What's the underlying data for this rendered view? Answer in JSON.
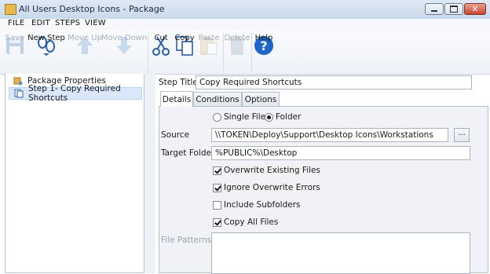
{
  "window": {
    "title": "All Users Desktop Icons - Package"
  },
  "menu": [
    "FILE",
    "EDIT",
    "STEPS",
    "VIEW"
  ],
  "ribbon": {
    "save": "Save",
    "new_step": "New Step",
    "move_up": "Move Up",
    "move_down": "Move Down",
    "cut": "Cut",
    "copy": "Copy",
    "paste": "Paste",
    "delete": "Delete",
    "help": "Help"
  },
  "tree": {
    "items": [
      {
        "label": "Package Properties",
        "icon": "package-properties-icon"
      },
      {
        "label": "Step 1- Copy Required Shortcuts",
        "icon": "step-copy-icon"
      }
    ]
  },
  "step": {
    "title_label": "Step Title",
    "title_value": "Copy Required Shortcuts",
    "tabs": [
      "Details",
      "Conditions",
      "Options"
    ],
    "mode": {
      "single_file": "Single File",
      "folder": "Folder",
      "selected": "Folder"
    },
    "source_label": "Source",
    "source_value": "\\\\TOKEN\\Deploy\\Support\\Desktop Icons\\Workstations",
    "browse_label": "...",
    "target_label": "Target Folder",
    "target_value": "%PUBLIC%\\Desktop",
    "options": [
      {
        "label": "Overwrite Existing Files",
        "checked": true
      },
      {
        "label": "Ignore Overwrite Errors",
        "checked": true
      },
      {
        "label": "Include Subfolders",
        "checked": false
      },
      {
        "label": "Copy All Files",
        "checked": true
      }
    ],
    "file_patterns_label": "File Patterns"
  },
  "colors": {
    "accent": "#2b6cc4",
    "help_blue": "#1e66c9"
  }
}
